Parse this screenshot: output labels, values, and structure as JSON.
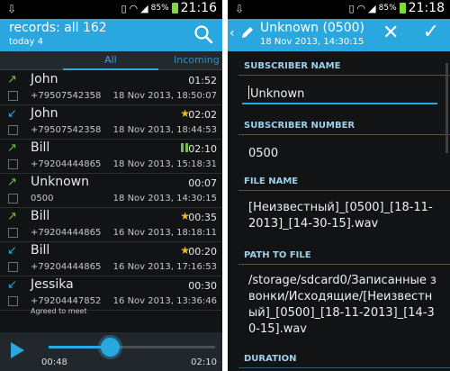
{
  "status_bar": {
    "left_icon": "usb-icon",
    "left": {
      "battery": "85%",
      "time": "21:16"
    },
    "right": {
      "battery": "85%",
      "time": "21:18"
    }
  },
  "list_screen": {
    "title": "records: all 162",
    "subtitle": "today 4",
    "tabs": {
      "all": "All",
      "incoming": "Incoming"
    },
    "records": [
      {
        "name": "John",
        "number": "+79507542358",
        "date": "18 Nov 2013, 18:50:07",
        "duration": "01:52",
        "direction": "outgoing",
        "starred": false,
        "playing": false,
        "note": ""
      },
      {
        "name": "John",
        "number": "+79507542358",
        "date": "18 Nov 2013, 18:44:53",
        "duration": "02:02",
        "direction": "incoming",
        "starred": true,
        "playing": false,
        "note": ""
      },
      {
        "name": "Bill",
        "number": "+79204444865",
        "date": "18 Nov 2013, 15:18:31",
        "duration": "02:10",
        "direction": "outgoing",
        "starred": false,
        "playing": true,
        "note": ""
      },
      {
        "name": "Unknown",
        "number": "0500",
        "date": "18 Nov 2013, 14:30:15",
        "duration": "00:07",
        "direction": "outgoing",
        "starred": false,
        "playing": false,
        "note": ""
      },
      {
        "name": "Bill",
        "number": "+79204444865",
        "date": "16 Nov 2013, 18:18:11",
        "duration": "00:35",
        "direction": "outgoing",
        "starred": true,
        "playing": false,
        "note": ""
      },
      {
        "name": "Bill",
        "number": "+79204444865",
        "date": "16 Nov 2013, 17:16:53",
        "duration": "00:20",
        "direction": "incoming",
        "starred": true,
        "playing": false,
        "note": ""
      },
      {
        "name": "Jessika",
        "number": "+79204447852",
        "date": "16 Nov 2013, 13:36:46",
        "duration": "00:30",
        "direction": "incoming",
        "starred": false,
        "playing": false,
        "note": "Agreed to meet"
      }
    ],
    "player": {
      "elapsed": "00:48",
      "total": "02:10",
      "progress": 0.37
    }
  },
  "detail_screen": {
    "title": "Unknown (0500)",
    "subtitle": "18 Nov 2013, 14:30:15",
    "sections": {
      "subscriber_name": {
        "label": "SUBSCRIBER NAME",
        "value": "Unknown"
      },
      "subscriber_number": {
        "label": "SUBSCRIBER NUMBER",
        "value": "0500"
      },
      "file_name": {
        "label": "FILE NAME",
        "value": "[Неизвестный]_[0500]_[18-11-2013]_[14-30-15].wav"
      },
      "path_to_file": {
        "label": "PATH TO FILE",
        "value": "/storage/sdcard0/Записанные звонки/Исходящие/[Неизвестный]_[0500]_[18-11-2013]_[14-30-15].wav"
      },
      "duration": {
        "label": "DURATION"
      }
    }
  },
  "colors": {
    "accent": "#2aa7df",
    "outgoing": "#6cc04a",
    "star": "#f2b820",
    "background": "#111315"
  }
}
